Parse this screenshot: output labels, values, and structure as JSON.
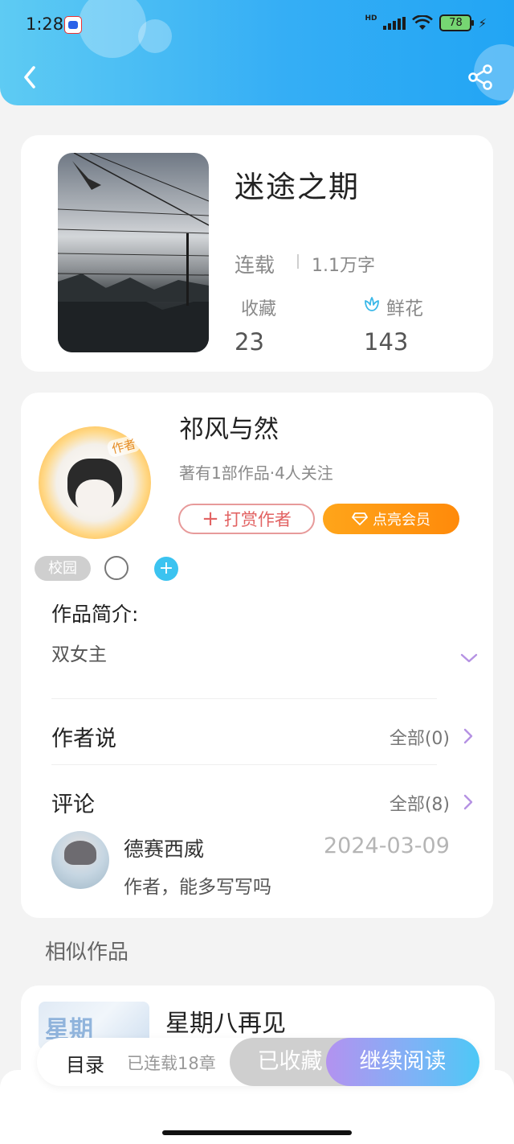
{
  "status_bar": {
    "time": "1:28",
    "network": "HD",
    "battery": "78",
    "charging_icon": "bolt-icon"
  },
  "header": {
    "back_icon": "chevron-left-icon",
    "share_icon": "share-icon"
  },
  "book": {
    "title": "迷途之期",
    "status": "连载",
    "word_count": "1.1万字",
    "favorites_label": "收藏",
    "favorites_count": "23",
    "flowers_label": "鲜花",
    "flowers_count": "143"
  },
  "author": {
    "name": "祁风与然",
    "meta": "著有1部作品·4人关注",
    "avatar_tag": "作者",
    "tip_button": "打赏作者",
    "vip_button": "点亮会员"
  },
  "tags": {
    "items": [
      "校园"
    ]
  },
  "intro": {
    "label": "作品简介:",
    "text": "双女主"
  },
  "author_says": {
    "label": "作者说",
    "link": "全部(0)"
  },
  "comments": {
    "label": "评论",
    "link": "全部(8)",
    "items": [
      {
        "user": "德赛西威",
        "date": "2024-03-09",
        "text": "作者，能多写写吗"
      }
    ]
  },
  "similar": {
    "section_title": "相似作品",
    "items": [
      {
        "title": "星期八再见",
        "cover_text": "星期"
      }
    ]
  },
  "bottom_bar": {
    "toc": "目录",
    "chapters": "已连载18章",
    "favorited": "已收藏",
    "continue": "继续阅读"
  },
  "colors": {
    "header_gradient_start": "#5ecbf3",
    "header_gradient_end": "#22a5f4",
    "accent_orange": "#ff8a0a",
    "tip_red": "#e26363",
    "tag_blue": "#3bc3f0",
    "read_gradient_start": "#b392f0",
    "read_gradient_end": "#4dc8f6"
  }
}
